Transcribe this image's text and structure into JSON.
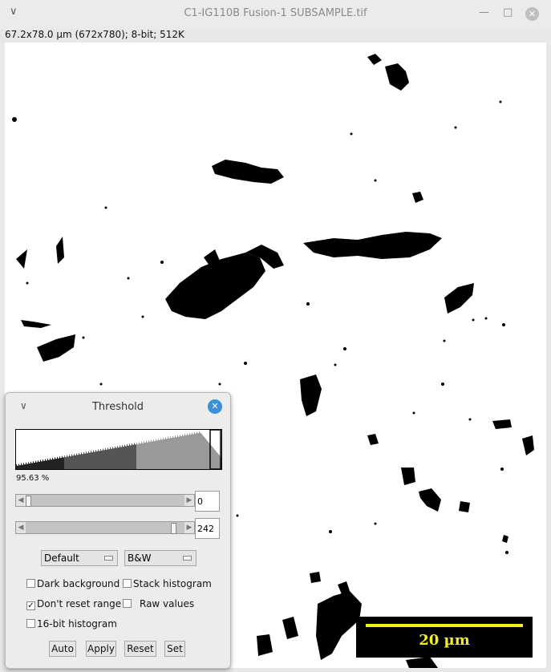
{
  "window": {
    "title": "C1-IG110B Fusion-1 SUBSAMPLE.tif",
    "menu_glyph": "∨",
    "minimize_glyph": "—",
    "maximize_glyph": "□",
    "close_glyph": "✕",
    "info": "67.2x78.0 µm (672x780); 8-bit; 512K"
  },
  "image": {
    "scale_bar_label": "20 µm",
    "scale_bar_color": "#f2f21a"
  },
  "threshold_dialog": {
    "title": "Threshold",
    "menu_glyph": "∨",
    "close_glyph": "✕",
    "percent": "95.63 %",
    "lower_value": "0",
    "upper_value": "242",
    "lower_fraction": 0,
    "upper_fraction": 0.949,
    "method": "Default",
    "display_mode": "B&W",
    "checkboxes": {
      "dark_background": {
        "label": "Dark background",
        "checked": false
      },
      "stack_histogram": {
        "label": "Stack histogram",
        "checked": false
      },
      "dont_reset_range": {
        "label": "Don't reset range",
        "checked": true
      },
      "raw_values": {
        "label": "Raw values",
        "checked": false
      },
      "hist_16bit": {
        "label": "16-bit histogram",
        "checked": false
      }
    },
    "buttons": {
      "auto": "Auto",
      "apply": "Apply",
      "reset": "Reset",
      "set": "Set"
    },
    "accent_color": "#3b8ed8"
  }
}
